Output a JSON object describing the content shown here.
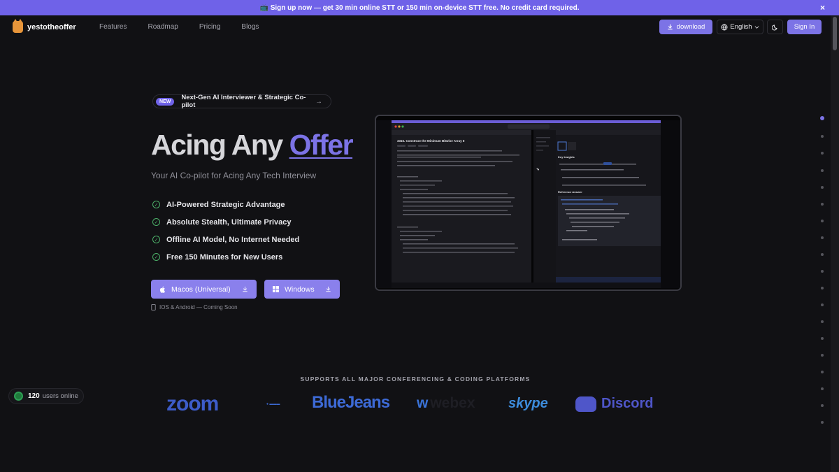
{
  "banner": {
    "text": "📺 Sign up now — get 30 min online STT or 150 min on-device STT free. No credit card required.",
    "close": "×"
  },
  "nav": {
    "brand": "yestotheoffer",
    "links": [
      "Features",
      "Roadmap",
      "Pricing",
      "Blogs"
    ],
    "download_label": "download",
    "language": "English",
    "signin_label": "Sign In"
  },
  "hero": {
    "badge_new": "NEW",
    "badge_text": "Next-Gen AI Interviewer & Strategic Co-pilot",
    "title_plain": "Acing Any ",
    "title_accent": "Offer",
    "subtitle": "Your AI Co-pilot for Acing Any Tech Interview",
    "features": [
      "AI-Powered Strategic Advantage",
      "Absolute Stealth, Ultimate Privacy",
      "Offline AI Model, No Internet Needed",
      "Free 150 Minutes for New Users"
    ],
    "mac_label": "Macos (Universal)",
    "win_label": "Windows",
    "coming_soon": "IOS & Android — Coming Soon"
  },
  "screenshot": {
    "problem_title": "3315. Construct the Minimum Bitwise Array II",
    "key_insights": "Key Insights",
    "reference_answer": "Reference Answer"
  },
  "platforms": {
    "title": "SUPPORTS ALL MAJOR CONFERENCING & CODING PLATFORMS",
    "zoom": "zoom",
    "bluejeans": "BlueJeans",
    "webex": "webex",
    "skype": "skype",
    "discord": "Discord"
  },
  "online": {
    "count": "120",
    "label": "users online"
  },
  "colors": {
    "accent": "#7c73e6",
    "banner": "#6f62e8",
    "check": "#4caf68",
    "background": "#111114"
  },
  "section_dots_active_index": 0
}
